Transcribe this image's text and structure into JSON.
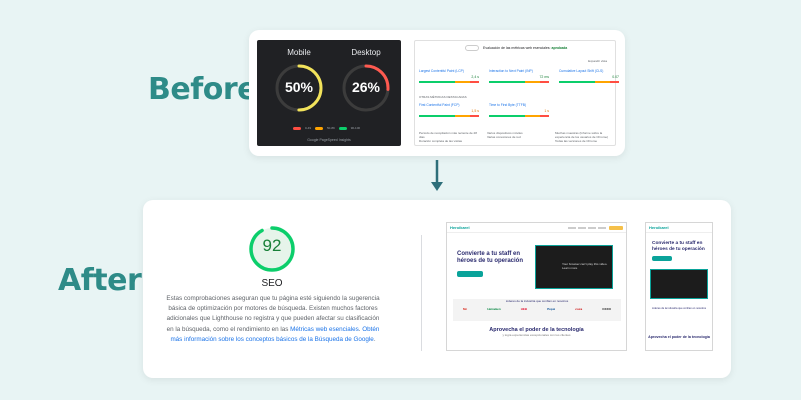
{
  "labels": {
    "before": "Before",
    "after": "After"
  },
  "colors": {
    "brand_teal": "#2e8b88",
    "score_green": "#0cce6b",
    "score_orange": "#ffa400",
    "score_red": "#ff4e42",
    "link_blue": "#1a73e8"
  },
  "before": {
    "psi": {
      "mobile_label": "Mobile",
      "mobile_score": "50%",
      "mobile_progress": 0.5,
      "desktop_label": "Desktop",
      "desktop_score": "26%",
      "desktop_progress": 0.26,
      "legend": [
        "0-49",
        "50-89",
        "90-100"
      ],
      "footer": "Google PageSpeed Insights"
    },
    "metrics": {
      "title_prefix": "Evaluación de las métricas web esenciales:",
      "title_status": "aprobada",
      "sub": "Expandir vista",
      "core": [
        {
          "name": "Largest Contentful Paint (LCP)",
          "value": "2,4 s",
          "tone": "green"
        },
        {
          "name": "Interaction to Next Paint (INP)",
          "value": "72 ms",
          "tone": "green"
        },
        {
          "name": "Cumulative Layout Shift (CLS)",
          "value": "0.07",
          "tone": "green"
        }
      ],
      "other_label": "OTRAS MÉTRICAS DESTACADAS",
      "other": [
        {
          "name": "First Contentful Paint (FCP)",
          "value": "1,5 s",
          "tone": "orange"
        },
        {
          "name": "Time to First Byte (TTFB)",
          "value": "1 s",
          "tone": "orange"
        }
      ],
      "notes": [
        "Período de recopilación más reciente de 28 días",
        "Varios dispositivos móviles",
        "Muchas muestras (Informe sobre la experiencia de los usuarios de Chrome)",
        "Duración completa de las visitas",
        "Varias conexiones de red",
        "Todas las versiones de Chrome"
      ]
    }
  },
  "after": {
    "score": "92",
    "score_progress": 0.92,
    "category": "SEO",
    "description": "Estas comprobaciones aseguran que tu página esté siguiendo la sugerencia básica de optimización por motores de búsqueda. Existen muchos factores adicionales que Lighthouse no registra y que pueden afectar su clasificación en la búsqueda, como el rendimiento en las",
    "link1": "Métricas web esenciales",
    "link_sep": ". ",
    "link2": "Obtén más información sobre los conceptos básicos de la Búsqueda de Google",
    "desc_end": ".",
    "desktop_shot": {
      "logo": "Heroikarel",
      "hero_title": "Convierte a tu staff en héroes de tu operación",
      "video_text": "Your browser can't play this video. Learn more",
      "strip_title": "Líderes de la industria que confían en nosotros",
      "logo_names": [
        "Mc",
        "Heineken",
        "HEB",
        "Pepsi",
        "coca",
        "OXXO"
      ],
      "bottom_title": "Aprovecha el poder de la tecnología",
      "bottom_sub": "y logra experiencias excepcionales con tus clientes"
    },
    "mobile_shot": {
      "logo": "Heroikarel",
      "hero_title": "Convierte a tu staff en héroes de tu operación",
      "strip_title": "Líderes de la industria que confían en nosotros",
      "bottom_title": "Aprovecha el poder de la tecnología"
    }
  }
}
